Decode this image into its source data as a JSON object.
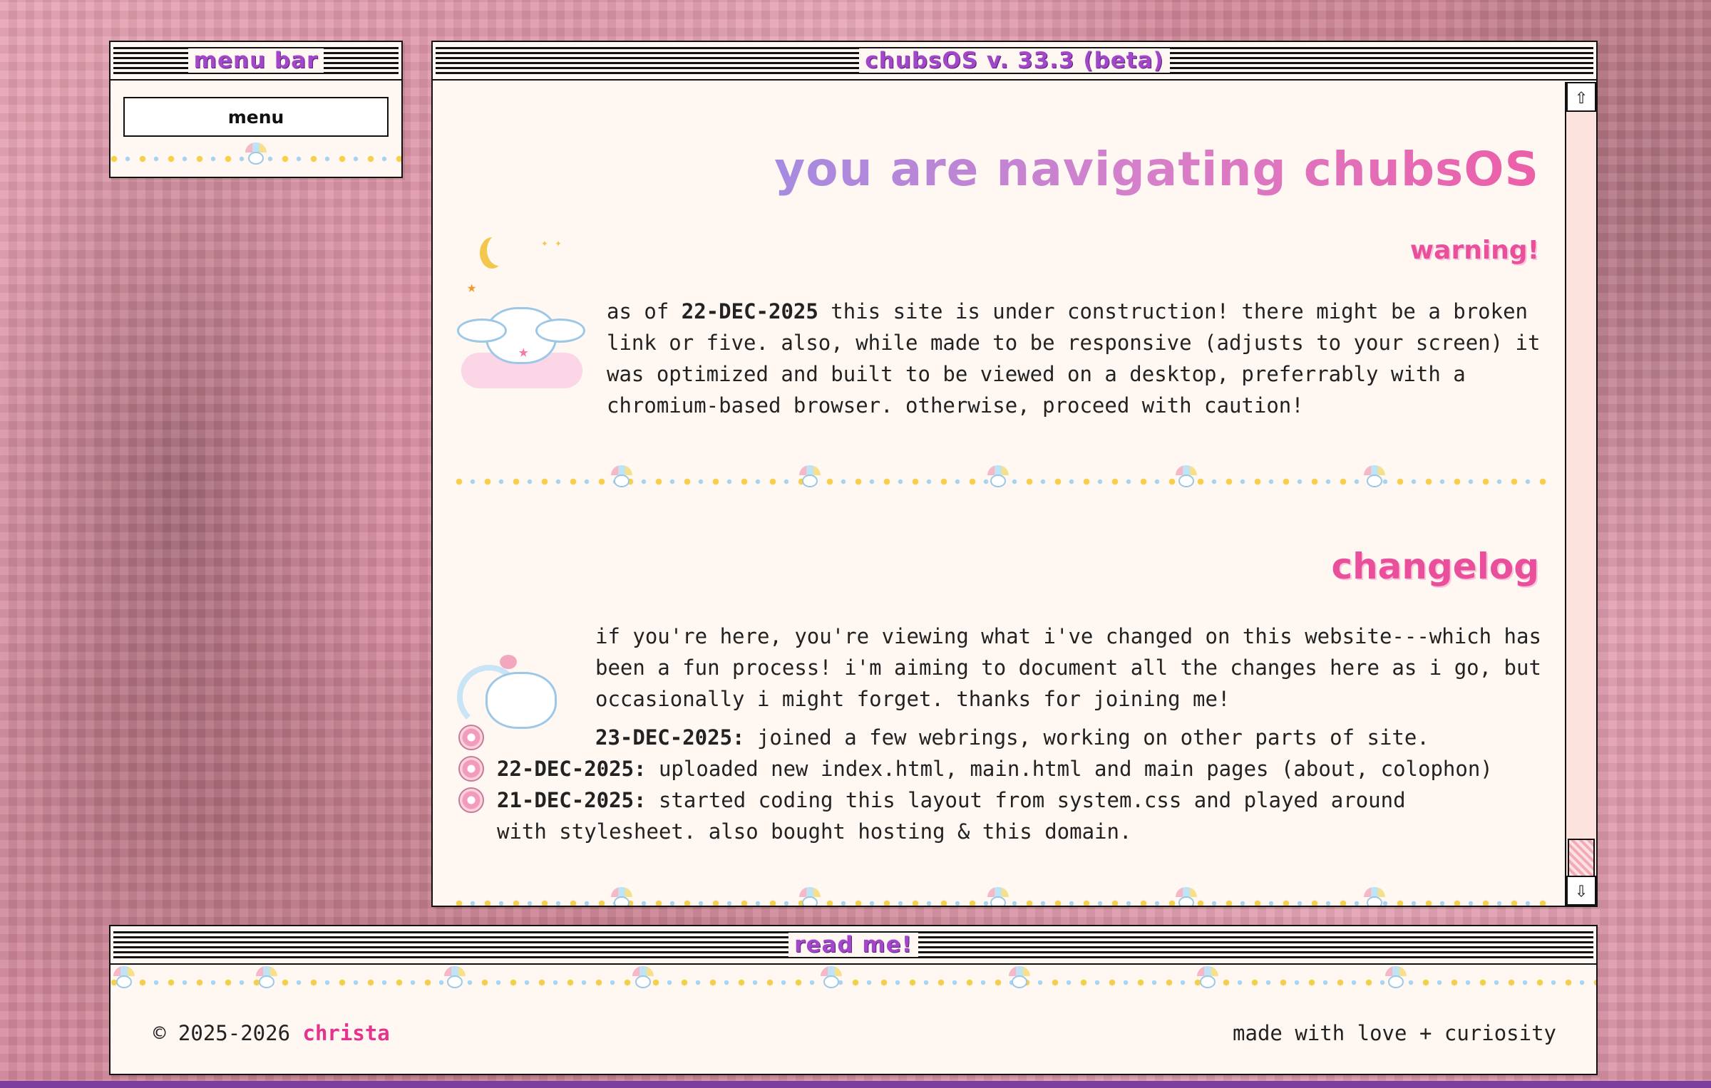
{
  "menu_window": {
    "title": "menu bar",
    "menu_button": "menu"
  },
  "main_window": {
    "title": "chubsOS v. 33.3 (beta)",
    "heading": "you are navigating chubsOS",
    "warning": {
      "title": "warning!",
      "text_prefix": "as of ",
      "date": "22-DEC-2025",
      "text_rest": " this site is under construction! there might be a broken link or five. also, while made to be responsive (adjusts to your screen) it was optimized and built to be viewed on a desktop, preferrably with a chromium-based browser. otherwise, proceed with caution!"
    },
    "changelog": {
      "title": "changelog",
      "intro": "if you're here, you're viewing what i've changed on this website---which has been a fun process! i'm aiming to document all the changes here as i go, but occasionally i might forget. thanks for joining me!",
      "entries": [
        {
          "date": "23-DEC-2025:",
          "text": " joined a few webrings, working on other parts of site."
        },
        {
          "date": "22-DEC-2025:",
          "text": " uploaded new index.html, main.html and main pages (about, colophon)"
        },
        {
          "date": "21-DEC-2025:",
          "text": " started coding this layout from system.css and played around with stylesheet. also bought hosting & this domain."
        }
      ]
    },
    "scroll_up_glyph": "⇧",
    "scroll_down_glyph": "⇩"
  },
  "footer_window": {
    "title": "read me!",
    "copyright": "© 2025-2026 ",
    "author": "christa",
    "tagline": "made with love + curiosity"
  },
  "colors": {
    "accent_pink": "#ea4f9b",
    "title_purple": "#a347c9",
    "window_bg": "#fff7f2"
  },
  "icons": [
    "cinnamoroll-moon-icon",
    "cinnamoroll-rainbow-icon",
    "cherry-blossom-icon",
    "umbrella-icon"
  ]
}
